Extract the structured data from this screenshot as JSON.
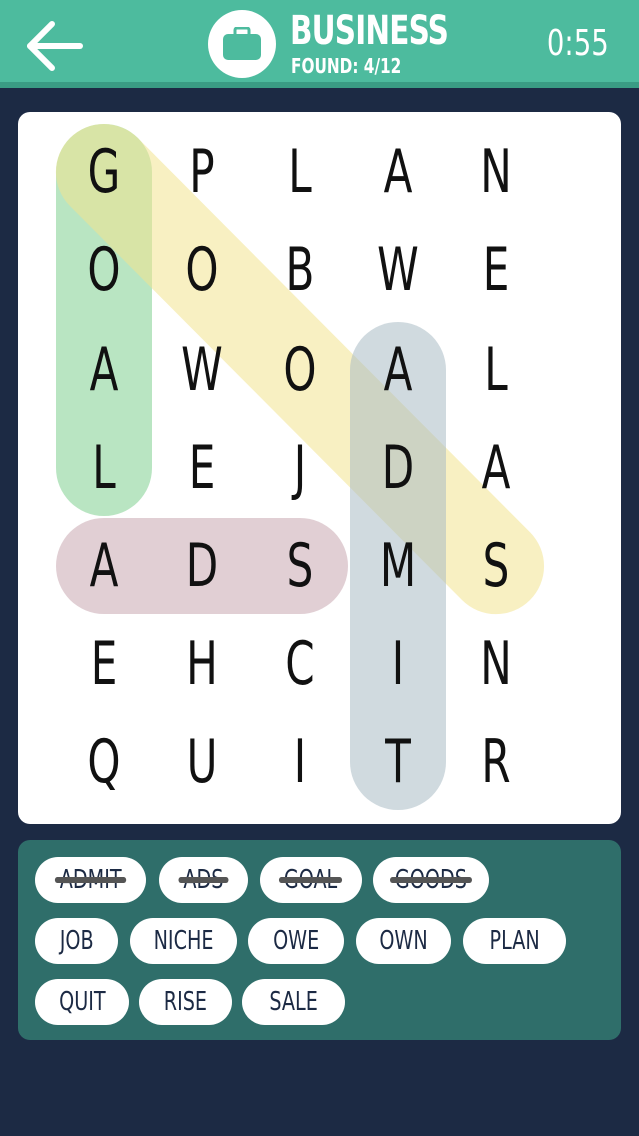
{
  "header": {
    "back_icon": "arrow-left-icon",
    "category_icon": "briefcase-icon",
    "category": "BUSINESS",
    "found": "FOUND: 4/12",
    "timer": "0:55",
    "color": "#4dbb9e"
  },
  "grid": {
    "rows": [
      [
        "G",
        "P",
        "L",
        "A",
        "N"
      ],
      [
        "O",
        "O",
        "B",
        "W",
        "E"
      ],
      [
        "A",
        "W",
        "O",
        "A",
        "L"
      ],
      [
        "L",
        "E",
        "J",
        "D",
        "A"
      ],
      [
        "A",
        "D",
        "S",
        "M",
        "S"
      ],
      [
        "E",
        "H",
        "C",
        "I",
        "N"
      ],
      [
        "Q",
        "U",
        "I",
        "T",
        "R"
      ]
    ]
  },
  "highlights": [
    {
      "word": "GOAL",
      "start": [
        0,
        0
      ],
      "end": [
        3,
        0
      ],
      "color": "#7fcf8f"
    },
    {
      "word": "GOODS",
      "start": [
        0,
        0
      ],
      "end": [
        4,
        4
      ],
      "color": "#f3e48f"
    },
    {
      "word": "ADMIT",
      "start": [
        2,
        3
      ],
      "end": [
        6,
        3
      ],
      "color": "#a9bcc4"
    },
    {
      "word": "ADS",
      "start": [
        4,
        0
      ],
      "end": [
        4,
        2
      ],
      "color": "#c9a8b0"
    }
  ],
  "words": [
    {
      "text": "ADMIT",
      "found": true
    },
    {
      "text": "ADS",
      "found": true
    },
    {
      "text": "GOAL",
      "found": true
    },
    {
      "text": "GOODS",
      "found": true
    },
    {
      "text": "JOB",
      "found": false
    },
    {
      "text": "NICHE",
      "found": false
    },
    {
      "text": "OWE",
      "found": false
    },
    {
      "text": "OWN",
      "found": false
    },
    {
      "text": "PLAN",
      "found": false
    },
    {
      "text": "QUIT",
      "found": false
    },
    {
      "text": "RISE",
      "found": false
    },
    {
      "text": "SALE",
      "found": false
    }
  ]
}
